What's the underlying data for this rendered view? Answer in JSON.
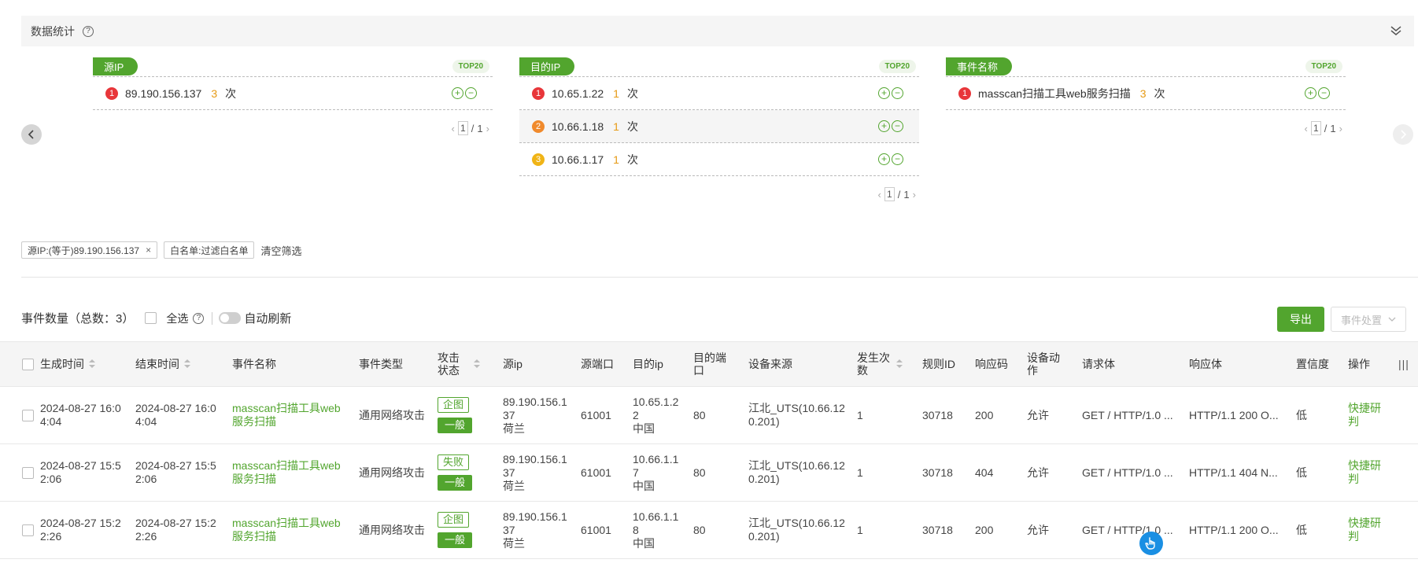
{
  "stats": {
    "title": "数据统计",
    "help": "?"
  },
  "panels": [
    {
      "label": "源IP",
      "badge": "TOP20",
      "rows": [
        {
          "rank": "1",
          "name": "89.190.156.137",
          "count": "3",
          "unit": "次"
        }
      ],
      "pager": {
        "current": "1",
        "sep": "/",
        "total": "1"
      }
    },
    {
      "label": "目的IP",
      "badge": "TOP20",
      "rows": [
        {
          "rank": "1",
          "name": "10.65.1.22",
          "count": "1",
          "unit": "次"
        },
        {
          "rank": "2",
          "name": "10.66.1.18",
          "count": "1",
          "unit": "次"
        },
        {
          "rank": "3",
          "name": "10.66.1.17",
          "count": "1",
          "unit": "次"
        }
      ],
      "pager": {
        "current": "1",
        "sep": "/",
        "total": "1"
      }
    },
    {
      "label": "事件名称",
      "badge": "TOP20",
      "rows": [
        {
          "rank": "1",
          "name": "masscan扫描工具web服务扫描",
          "count": "3",
          "unit": "次"
        }
      ],
      "pager": {
        "current": "1",
        "sep": "/",
        "total": "1"
      }
    }
  ],
  "filters": {
    "chips": [
      "源IP:(等于)89.190.156.137",
      "白名单:过滤白名单"
    ],
    "chip_close": "×",
    "clear": "清空筛选"
  },
  "events": {
    "count_label": "事件数量（总数：3）",
    "select_all": "全选",
    "help": "?",
    "auto_refresh": "自动刷新",
    "export": "导出",
    "dispose": "事件处置"
  },
  "table": {
    "headers": [
      "生成时间",
      "结束时间",
      "事件名称",
      "事件类型",
      "攻击状态",
      "源ip",
      "源端口",
      "目的ip",
      "目的端口",
      "设备来源",
      "发生次数",
      "规则ID",
      "响应码",
      "设备动作",
      "请求体",
      "响应体",
      "置信度",
      "操作"
    ],
    "rows": [
      {
        "start": "2024-08-27 16:04:04",
        "end": "2024-08-27 16:04:04",
        "name": "masscan扫描工具web服务扫描",
        "type": "通用网络攻击",
        "status": "企图",
        "level": "一般",
        "src_ip": "89.190.156.137",
        "src_country": "荷兰",
        "src_port": "61001",
        "dst_ip": "10.65.1.22",
        "dst_country": "中国",
        "dst_port": "80",
        "device": "江北_UTS(10.66.120.201)",
        "times": "1",
        "rule_id": "30718",
        "resp_code": "200",
        "action": "允许",
        "request": "GET / HTTP/1.0 ...",
        "response": "HTTP/1.1 200 O...",
        "confidence": "低",
        "op": "快捷研判"
      },
      {
        "start": "2024-08-27 15:52:06",
        "end": "2024-08-27 15:52:06",
        "name": "masscan扫描工具web服务扫描",
        "type": "通用网络攻击",
        "status": "失败",
        "level": "一般",
        "src_ip": "89.190.156.137",
        "src_country": "荷兰",
        "src_port": "61001",
        "dst_ip": "10.66.1.17",
        "dst_country": "中国",
        "dst_port": "80",
        "device": "江北_UTS(10.66.120.201)",
        "times": "1",
        "rule_id": "30718",
        "resp_code": "404",
        "action": "允许",
        "request": "GET / HTTP/1.0 ...",
        "response": "HTTP/1.1 404 N...",
        "confidence": "低",
        "op": "快捷研判"
      },
      {
        "start": "2024-08-27 15:22:26",
        "end": "2024-08-27 15:22:26",
        "name": "masscan扫描工具web服务扫描",
        "type": "通用网络攻击",
        "status": "企图",
        "level": "一般",
        "src_ip": "89.190.156.137",
        "src_country": "荷兰",
        "src_port": "61001",
        "dst_ip": "10.66.1.18",
        "dst_country": "中国",
        "dst_port": "80",
        "device": "江北_UTS(10.66.120.201)",
        "times": "1",
        "rule_id": "30718",
        "resp_code": "200",
        "action": "允许",
        "request": "GET / HTTP/1.0 ...",
        "response": "HTTP/1.1 200 O...",
        "confidence": "低",
        "op": "快捷研判"
      }
    ]
  },
  "colors": {
    "brand": "#52a52e",
    "rank1": "#e8363a",
    "rank2": "#f08a2c",
    "rank3": "#f0b416",
    "count": "#e69a14"
  }
}
